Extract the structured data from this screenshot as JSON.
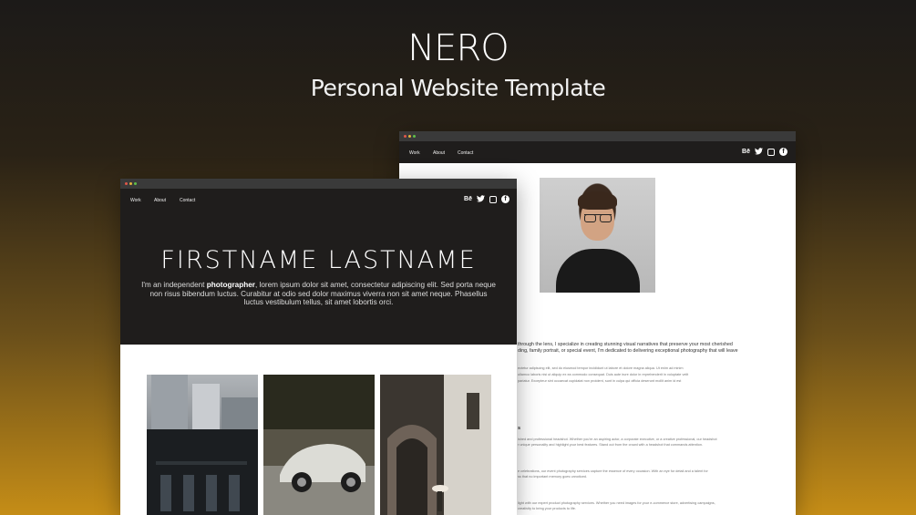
{
  "hero": {
    "title": "NERO",
    "subtitle": "Personal Website Template"
  },
  "nav": {
    "links": [
      "Work",
      "About",
      "Contact"
    ],
    "social": [
      "behance-icon",
      "twitter-icon",
      "instagram-icon",
      "facebook-icon"
    ],
    "behance_label": "Bē"
  },
  "front": {
    "name": "FIRSTNAME LASTNAME",
    "intro_prefix": "I'm an independent ",
    "intro_bold": "photographer",
    "intro_suffix": ", lorem ipsum dolor sit amet, consectetur adipiscing elit. Sed porta neque non risus bibendum luctus. Curabitur at odio sed dolor maximus viverra non sit amet neque. Phasellus luctus vestibulum tellus, sit amet lobortis orci."
  },
  "back": {
    "about_line1": "through the lens, I specialize in creating stunning visual narratives that preserve your most cherished",
    "about_line2": "ding, family portrait, or special event, I'm dedicated to delivering exceptional photography that will leave",
    "lorem1": "ectetur adipiscing elit, sed do eiusmod tempor incididunt ut labore et dolore magna aliqua. Ut enim ad minim",
    "lorem2": "ullamco laboris nisi ut aliquip ex ea commodo consequat. Duis aute irure dolor in reprehenderit in voluptate velit",
    "lorem3": "pariatur. Excepteur sint occaecat cupidatat non proident, sunt in culpa qui officia deserunt mollit anim id est",
    "service_heading_tail": "s",
    "svc1a": "ished and professional headshot. Whether you're an aspiring actor, a corporate executive, or a creative professional, our headshot",
    "svc1b": "r unique personality and highlight your best features. Stand out from the crowd with a headshot that commands attention.",
    "svc2a": "e celebrations, our event photography services capture the essence of every occasion. With an eye for detail and a talent for",
    "svc2b": "ss that no important memory goes unnoticed.",
    "svc3a": "light with our expert product photography services. Whether you need images for your e-commerce store, advertising campaigns,",
    "svc3b": "creativity to bring your products to life."
  },
  "colors": {
    "nav_bg": "#1f1d1c",
    "dot_red": "#e0574a",
    "dot_yellow": "#e3b33b",
    "dot_green": "#5fbf4a"
  }
}
